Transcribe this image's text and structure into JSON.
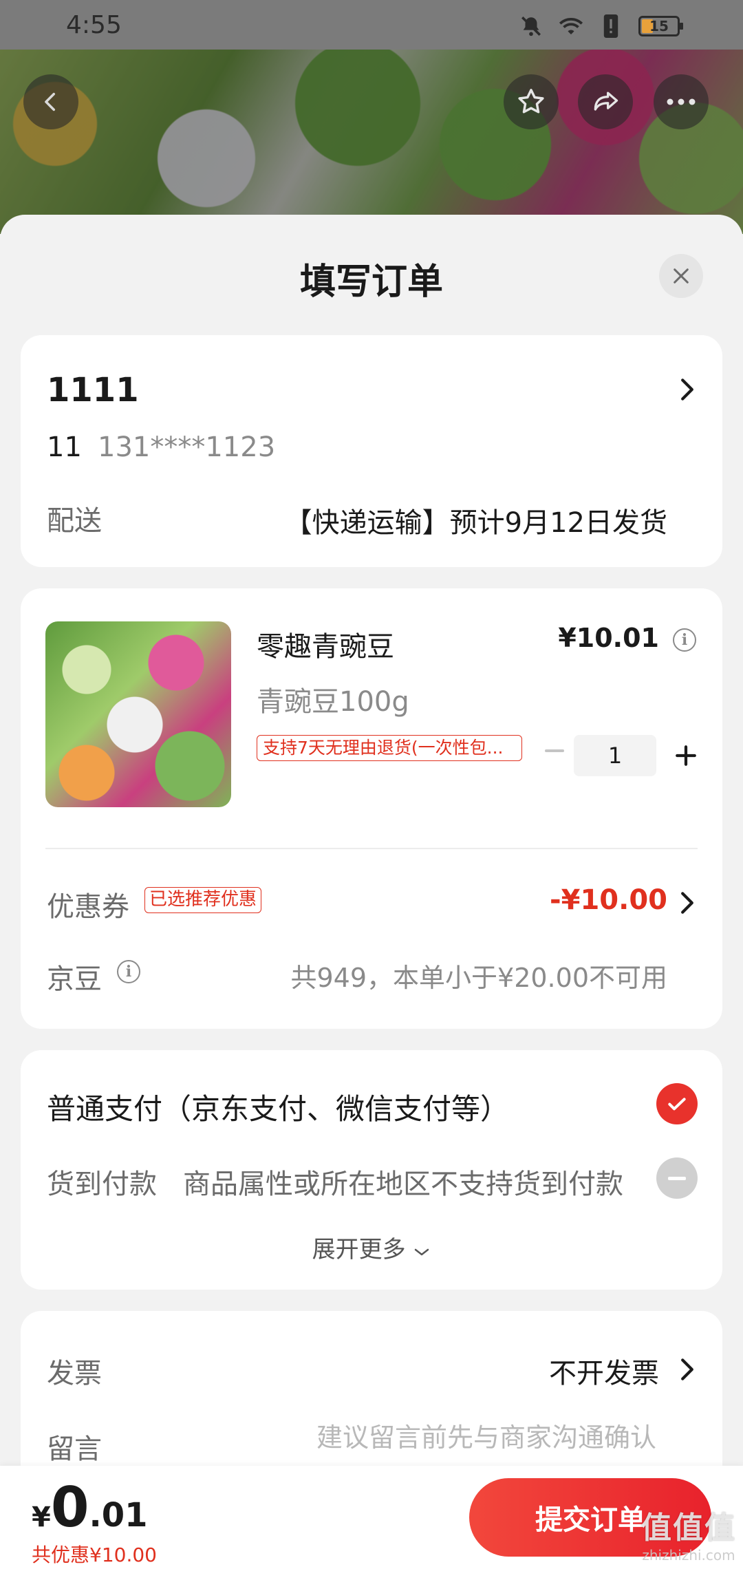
{
  "status_bar": {
    "time": "4:55",
    "battery": "15"
  },
  "sheet": {
    "title": "填写订单"
  },
  "address": {
    "name": "1111",
    "contact": "11",
    "phone": "131****1123",
    "shipping_label": "配送",
    "shipping_value": "【快递运输】预计9月12日发货"
  },
  "product": {
    "name": "零趣青豌豆",
    "price": "¥10.01",
    "spec": "青豌豆100g",
    "return_tag": "支持7天无理由退货(一次性包...",
    "quantity": "1"
  },
  "coupon": {
    "label": "优惠券",
    "tag": "已选推荐优惠",
    "value": "-¥10.00"
  },
  "jingdou": {
    "label": "京豆",
    "value": "共949，本单小于¥20.00不可用"
  },
  "payment": {
    "option1": "普通支付（京东支付、微信支付等）",
    "option2": "货到付款",
    "option2_note": "商品属性或所在地区不支持货到付款",
    "expand": "展开更多"
  },
  "invoice": {
    "label": "发票",
    "value": "不开发票"
  },
  "message": {
    "label": "留言",
    "placeholder": "建议留言前先与商家沟通确认"
  },
  "bottom": {
    "currency": "¥",
    "total_int": "0",
    "total_dec": ".01",
    "saved": "共优惠¥10.00",
    "submit": "提交订单"
  },
  "watermark": {
    "main": "值值值",
    "sub": "zhizhizhi.com"
  },
  "colors": {
    "accent": "#e8322c",
    "text": "#1a1a1a",
    "muted": "#8a8a8a"
  }
}
